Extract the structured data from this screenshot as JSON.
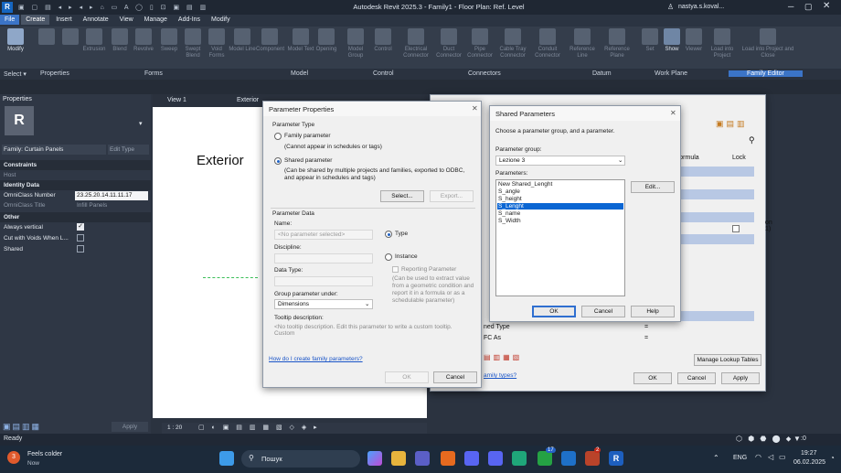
{
  "titlebar": {
    "title": "Autodesk Revit 2025.3 - Family1 - Floor Plan: Ref. Level",
    "user": "nastya.s.koval...",
    "app_badge": "R"
  },
  "menubar": {
    "items": [
      "File",
      "Create",
      "Insert",
      "Annotate",
      "View",
      "Manage",
      "Add-Ins",
      "Modify"
    ],
    "active": "Create"
  },
  "ribbon": {
    "buttons": [
      "Modify",
      "Type Properties",
      "Family Types",
      "Extrusion",
      "Blend",
      "Revolve",
      "Sweep",
      "Swept Blend",
      "Void Forms",
      "Model Line",
      "Component",
      "Model Text",
      "Opening",
      "Model Group",
      "Control",
      "Electrical Connector",
      "Duct Connector",
      "Pipe Connector",
      "Cable Tray Connector",
      "Conduit Connector",
      "Reference Line",
      "Reference Plane",
      "Set",
      "Show",
      "Viewer",
      "Load into Project",
      "Load into Project and Close"
    ],
    "groups": [
      "Select ▾",
      "Properties",
      "Forms",
      "Model",
      "Control",
      "Connectors",
      "Datum",
      "Work Plane",
      "Family Editor"
    ]
  },
  "properties": {
    "panel_title": "Properties",
    "family": "Family: Curtain Panels",
    "edit_type": "Edit Type",
    "constraints_label": "Constraints",
    "host_label": "Host",
    "identity_label": "Identity Data",
    "omniclass_number_label": "OmniClass Number",
    "omniclass_number_value": "23.25.20.14.11.11.17",
    "omniclass_title_label": "OmniClass Title",
    "omniclass_title_value": "Infill Panels",
    "other_label": "Other",
    "always_vertical": "Always vertical",
    "cut_voids": "Cut with Voids When L...",
    "shared": "Shared",
    "apply": "Apply"
  },
  "view": {
    "tab1": "View 1",
    "tab2": "Exterior",
    "canvas_label": "Exterior",
    "scale": "1 : 20"
  },
  "param_props": {
    "title": "Parameter Properties",
    "param_type": "Parameter Type",
    "family_param": "Family parameter",
    "family_hint": "(Cannot appear in schedules or tags)",
    "shared_param": "Shared parameter",
    "shared_hint": "(Can be shared by multiple projects and families, exported to ODBC, and appear in schedules and tags)",
    "select": "Select...",
    "export": "Export...",
    "param_data": "Parameter Data",
    "name": "Name:",
    "name_placeholder": "<No parameter selected>",
    "type": "Type",
    "instance": "Instance",
    "discipline": "Discipline:",
    "data_type": "Data Type:",
    "reporting": "Reporting Parameter",
    "reporting_hint": "(Can be used to extract value from a geometric condition and report it in a formula or as a schedulable parameter)",
    "group_under": "Group parameter under:",
    "group_value": "Dimensions",
    "tooltip_desc": "Tooltip description:",
    "tooltip_text": "<No tooltip description. Edit this parameter to write a custom tooltip. Custom",
    "help_link": "How do I create family parameters?",
    "ok": "OK",
    "cancel": "Cancel"
  },
  "shared_params": {
    "title": "Shared Parameters",
    "instruction": "Choose a parameter group, and a parameter.",
    "group_label": "Parameter group:",
    "group_value": "Lezione 3",
    "params_label": "Parameters:",
    "params": [
      "New Shared_Lenght",
      "S_angle",
      "S_height",
      "S_Lenght",
      "S_name",
      "S_Width"
    ],
    "selected": "S_Lenght",
    "edit": "Edit...",
    "ok": "OK",
    "cancel": "Cancel",
    "help": "Help"
  },
  "family_types": {
    "formula": "Formula",
    "lock": "Lock",
    "row_ned_type": "ned Type",
    "row_fc_as": "FC As",
    "eq": "=",
    "side_text": "on 1)",
    "manage_lookup": "Manage Lookup Tables",
    "link": "amily types?",
    "ok": "OK",
    "cancel": "Cancel",
    "apply": "Apply"
  },
  "statusbar": {
    "text": "Ready",
    "zero": ":0"
  },
  "taskbar": {
    "weather_temp": "3",
    "weather": "Feels colder",
    "weather_sub": "Now",
    "search": "Пошук",
    "lang": "ENG",
    "time": "19:27",
    "date": "06.02.2025",
    "badge_teams": "2",
    "badge_whatsapp": "17"
  }
}
